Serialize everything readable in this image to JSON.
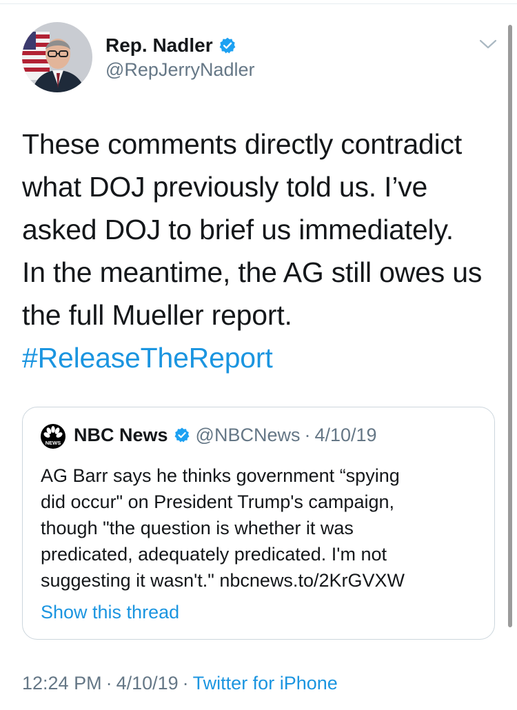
{
  "tweet": {
    "author_name": "Rep. Nadler",
    "author_handle": "@RepJerryNadler",
    "text_lines": [
      "These comments directly contradict",
      "what DOJ previously told us.  I’ve",
      "asked DOJ to brief us immediately.",
      "In the meantime, the AG still owes us",
      "the full Mueller report."
    ],
    "hashtag": "#ReleaseTheReport",
    "time": "12:24 PM",
    "date": "4/10/19",
    "source": "Twitter for iPhone",
    "separator": "·"
  },
  "quoted_tweet": {
    "author_name": "NBC News",
    "author_handle": "@NBCNews",
    "separator": "·",
    "date": "4/10/19",
    "text_lines": [
      "AG Barr says he thinks government “spying",
      "did occur\" on President Trump's campaign,",
      "though \"the question is whether it was",
      "predicated, adequately predicated. I'm not",
      "suggesting it wasn't.\" nbcnews.to/2KrGVXW"
    ],
    "show_thread_label": "Show this thread",
    "logo_text": "NEWS"
  },
  "icons": {
    "avatar": "avatar-photo",
    "verified": "verified-badge-icon",
    "menu": "chevron-down-icon",
    "nbc_logo": "nbc-peacock-logo"
  },
  "colors": {
    "link_blue": "#1b95e0",
    "verified_blue": "#1da1f2",
    "secondary_gray": "#657786",
    "text": "#14171a",
    "border": "#ccd6dd"
  }
}
